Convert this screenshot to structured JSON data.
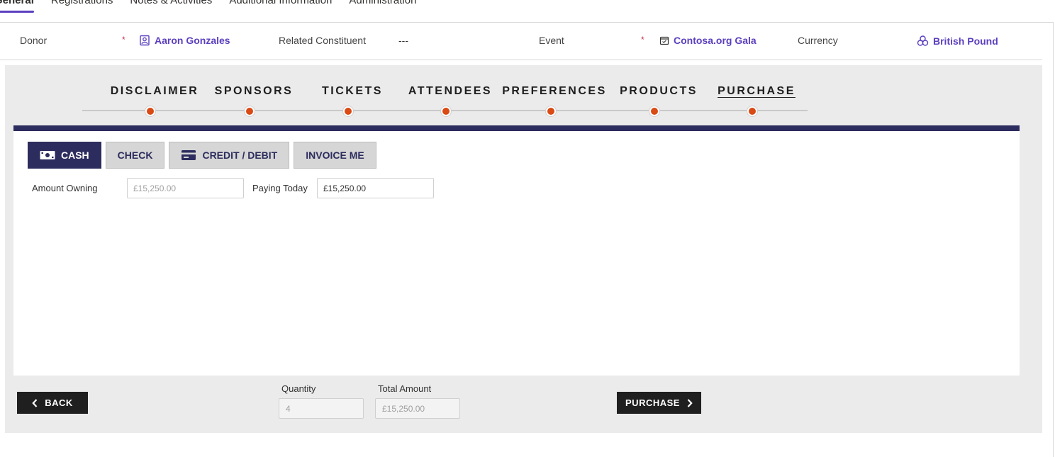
{
  "tabs": [
    {
      "label": "General",
      "active": true
    },
    {
      "label": "Registrations",
      "active": false
    },
    {
      "label": "Notes & Activities",
      "active": false
    },
    {
      "label": "Additional Information",
      "active": false
    },
    {
      "label": "Administration",
      "active": false
    }
  ],
  "header": {
    "donor_label": "Donor",
    "required_mark": "*",
    "donor_value": "Aaron Gonzales",
    "related_label": "Related Constituent",
    "related_value": "---",
    "event_label": "Event",
    "event_value": "Contosa.org Gala",
    "currency_label": "Currency",
    "currency_value": "British Pound",
    "link_color": "#5b3fbf"
  },
  "steps": [
    {
      "label": "DISCLAIMER",
      "active": false
    },
    {
      "label": "SPONSORS",
      "active": false
    },
    {
      "label": "TICKETS",
      "active": false
    },
    {
      "label": "ATTENDEES",
      "active": false
    },
    {
      "label": "PREFERENCES",
      "active": false
    },
    {
      "label": "PRODUCTS",
      "active": false
    },
    {
      "label": "PURCHASE",
      "active": true
    }
  ],
  "payment_tabs": {
    "cash": "CASH",
    "check": "CHECK",
    "credit": "CREDIT / DEBIT",
    "invoice": "INVOICE ME",
    "active": "cash"
  },
  "payment": {
    "amount_owning_label": "Amount Owning",
    "amount_owning_value": "£15,250.00",
    "paying_today_label": "Paying Today",
    "paying_today_value": "£15,250.00"
  },
  "footer": {
    "back_label": "BACK",
    "quantity_label": "Quantity",
    "quantity_value": "4",
    "total_label": "Total Amount",
    "total_value": "£15,250.00",
    "purchase_label": "PURCHASE"
  },
  "colors": {
    "accent": "#5b3fbf",
    "navy": "#2c2c5e",
    "step_dot": "#d94a14"
  }
}
